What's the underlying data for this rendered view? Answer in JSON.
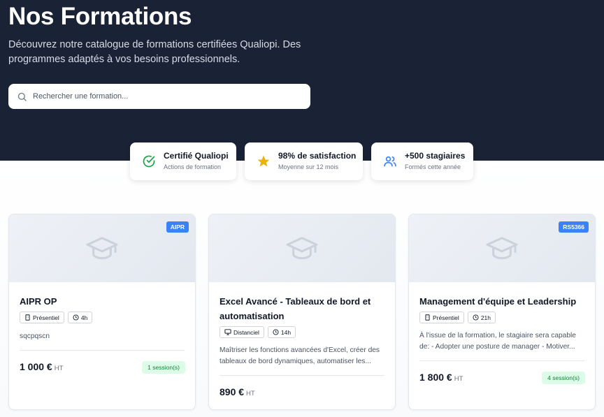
{
  "hero": {
    "title": "Nos Formations",
    "subtitle": "Découvrez notre catalogue de formations certifiées Qualiopi. Des programmes adaptés à vos besoins professionnels.",
    "search_placeholder": "Rechercher une formation..."
  },
  "stats": [
    {
      "icon": "check-circle-icon",
      "title": "Certifié Qualiopi",
      "sub": "Actions de formation",
      "color": "#16a34a"
    },
    {
      "icon": "star-icon",
      "title": "98% de satisfaction",
      "sub": "Moyenne sur 12 mois",
      "color": "#eab308"
    },
    {
      "icon": "users-icon",
      "title": "+500 stagiaires",
      "sub": "Formés cette année",
      "color": "#3b82f6"
    }
  ],
  "courses": [
    {
      "badge": "AIPR",
      "title": "AIPR OP",
      "tags": [
        {
          "icon": "building-icon",
          "label": "Présentiel"
        },
        {
          "icon": "clock-icon",
          "label": "4h"
        }
      ],
      "description": "sqcpqscn",
      "price": "1 000 €",
      "price_suffix": "HT",
      "sessions": "1 session(s)"
    },
    {
      "badge": "",
      "title": "Excel Avancé - Tableaux de bord et automatisation",
      "tags": [
        {
          "icon": "monitor-icon",
          "label": "Distanciel"
        },
        {
          "icon": "clock-icon",
          "label": "14h"
        }
      ],
      "description": "Maîtriser les fonctions avancées d'Excel, créer des tableaux de bord dynamiques, automatiser les...",
      "price": "890 €",
      "price_suffix": "HT",
      "sessions": ""
    },
    {
      "badge": "RS5366",
      "title": "Management d'équipe et Leadership",
      "tags": [
        {
          "icon": "building-icon",
          "label": "Présentiel"
        },
        {
          "icon": "clock-icon",
          "label": "21h"
        }
      ],
      "description": "À l'issue de la formation, le stagiaire sera capable de: - Adopter une posture de manager - Motiver...",
      "price": "1 800 €",
      "price_suffix": "HT",
      "sessions": "4 session(s)"
    }
  ]
}
